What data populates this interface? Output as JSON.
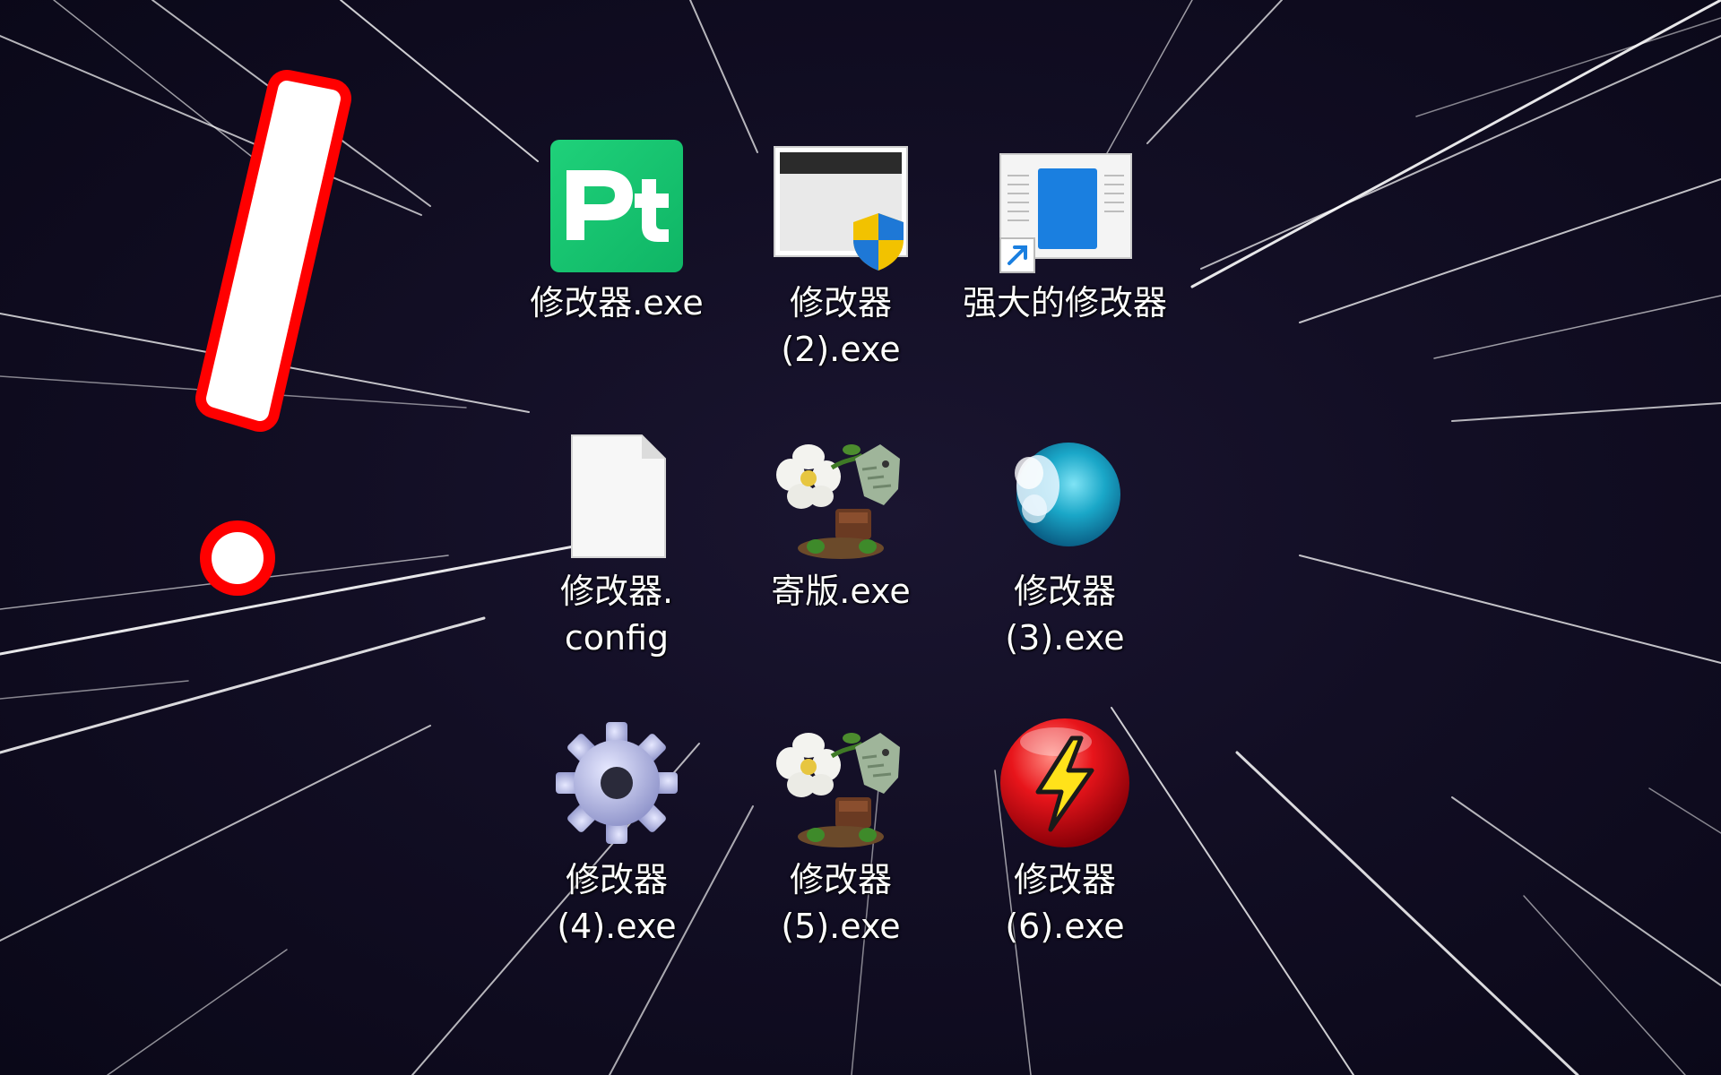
{
  "desktop": {
    "background_color": "#0d0a1c",
    "accent_color": "#ff0000",
    "icons": [
      {
        "label": "修改器.exe",
        "icon": "pt-green-app-icon"
      },
      {
        "label": "修改器\n(2).exe",
        "icon": "window-shield-icon"
      },
      {
        "label": "强大的修改器",
        "icon": "shortcut-document-icon"
      },
      {
        "label": "修改器.\nconfig",
        "icon": "blank-file-icon"
      },
      {
        "label": "寄版.exe",
        "icon": "plants-vs-zombies-icon"
      },
      {
        "label": "修改器\n(3).exe",
        "icon": "blue-orb-icon"
      },
      {
        "label": "修改器\n(4).exe",
        "icon": "gear-icon"
      },
      {
        "label": "修改器\n(5).exe",
        "icon": "plants-vs-zombies-icon"
      },
      {
        "label": "修改器\n(6).exe",
        "icon": "red-lightning-icon"
      }
    ]
  }
}
